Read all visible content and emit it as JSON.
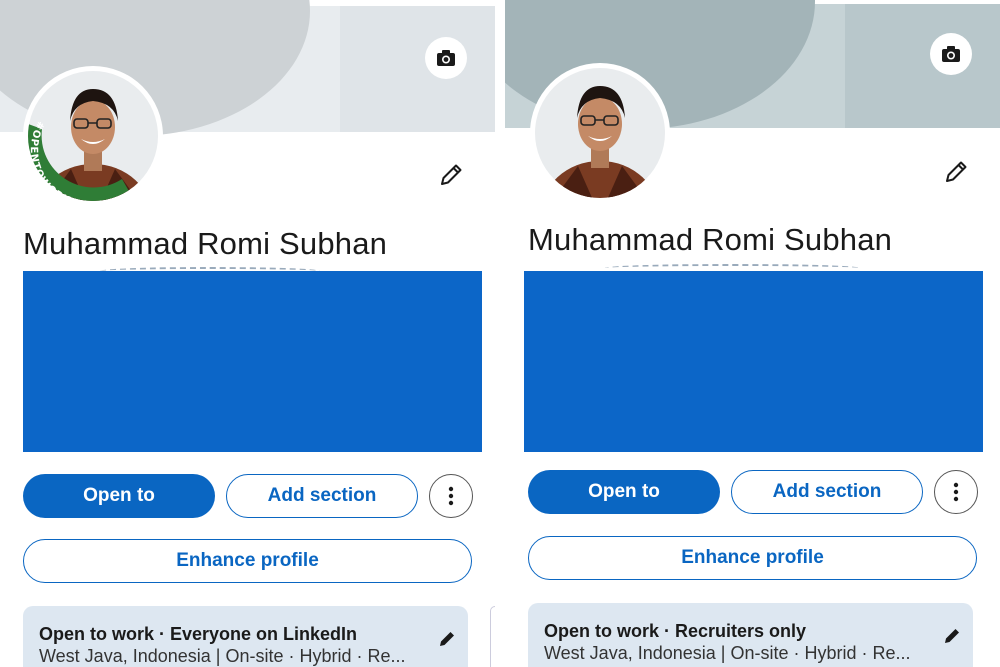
{
  "panels": [
    {
      "id": "left",
      "name": "Muhammad Romi Subhan",
      "avatar_badge": "#OPENTOWORK",
      "buttons": {
        "open_to": "Open to",
        "add_section": "Add section",
        "enhance_profile": "Enhance profile"
      },
      "open_to_work": {
        "title": "Open to work · Everyone on LinkedIn",
        "details": "West Java, Indonesia | On-site · Hybrid · Re..."
      }
    },
    {
      "id": "right",
      "name": "Muhammad Romi Subhan",
      "buttons": {
        "open_to": "Open to",
        "add_section": "Add section",
        "enhance_profile": "Enhance profile"
      },
      "open_to_work": {
        "title": "Open to work · Recruiters only",
        "details": "West Java, Indonesia | On-site · Hybrid · Re..."
      }
    }
  ],
  "colors": {
    "primary": "#0a66c2",
    "redaction": "#0c66c8",
    "open_to_work_badge": "#2e7d32",
    "card_background": "#dde7f1"
  },
  "icons": [
    "camera-icon",
    "pencil-icon",
    "more-vertical-icon",
    "edit-icon"
  ]
}
